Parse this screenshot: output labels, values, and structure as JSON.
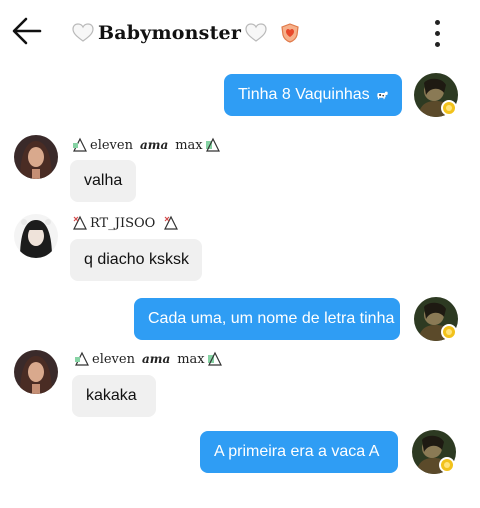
{
  "header": {
    "title": "Babymonster",
    "back_icon": "arrow-left-icon",
    "menu_icon": "more-vertical-icon",
    "left_heart": "white-heart-icon",
    "right_heart": "white-heart-icon",
    "badge_icon": "shield-heart-icon"
  },
  "messages": [
    {
      "side": "out",
      "text": "Tinha 8 Vaquinhas",
      "emoji": "cow-icon"
    },
    {
      "side": "in",
      "sender": {
        "name_a": "eleven",
        "name_mid": "ama",
        "name_b": "max"
      },
      "text": "valha"
    },
    {
      "side": "in",
      "sender": {
        "name_a": "RT_JISOO"
      },
      "text": "q diacho ksksk"
    },
    {
      "side": "out",
      "text": "Cada uma, um nome de letra tinha"
    },
    {
      "side": "in",
      "sender": {
        "name_a": "eleven",
        "name_mid": "ama",
        "name_b": "max"
      },
      "text": "kakaka"
    },
    {
      "side": "out",
      "text": "A primeira era a vaca A"
    }
  ],
  "colors": {
    "outgoing_bubble": "#2f9df4",
    "incoming_bubble": "#f0f0f0",
    "badge": "#f2c21b"
  }
}
